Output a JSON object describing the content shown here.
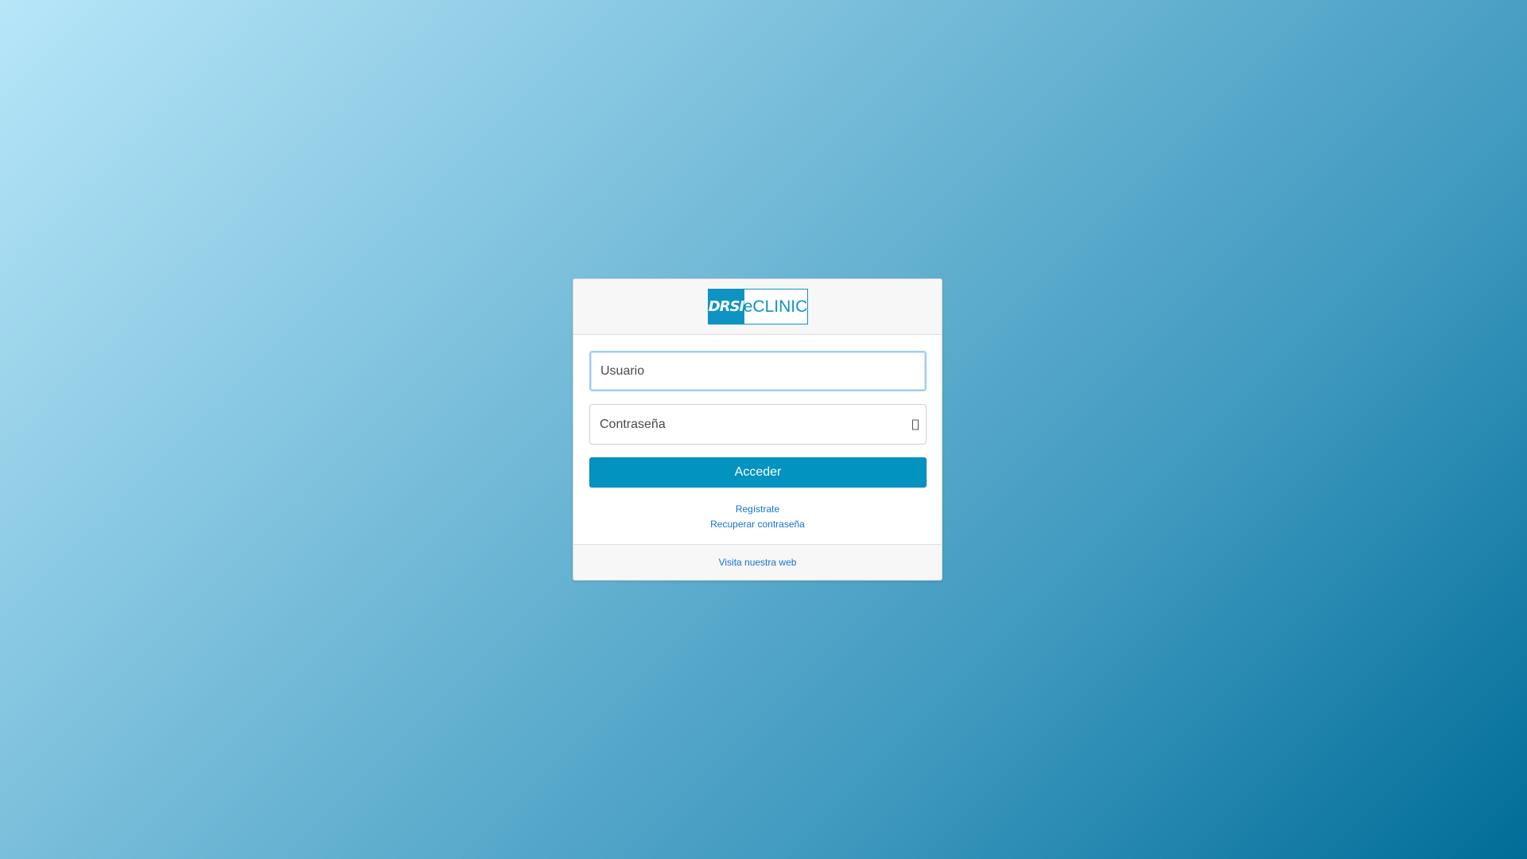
{
  "logo": {
    "mark_text": "DRSI",
    "product_text": "eCLINIC",
    "brand_color": "#0f93c2"
  },
  "form": {
    "username": {
      "placeholder": "Usuario",
      "value": ""
    },
    "password": {
      "placeholder": "Contraseña",
      "value": "",
      "toggle_icon": "eye-icon"
    },
    "submit_label": "Acceder",
    "submit_color": "#0393c1"
  },
  "links": {
    "register": "Regístrate",
    "recover_password": "Recuperar contraseña"
  },
  "footer": {
    "visit_site": "Visita nuestra web"
  },
  "colors": {
    "link": "#1373d6",
    "background_start": "#b7e6f9",
    "background_end": "#006d98"
  }
}
